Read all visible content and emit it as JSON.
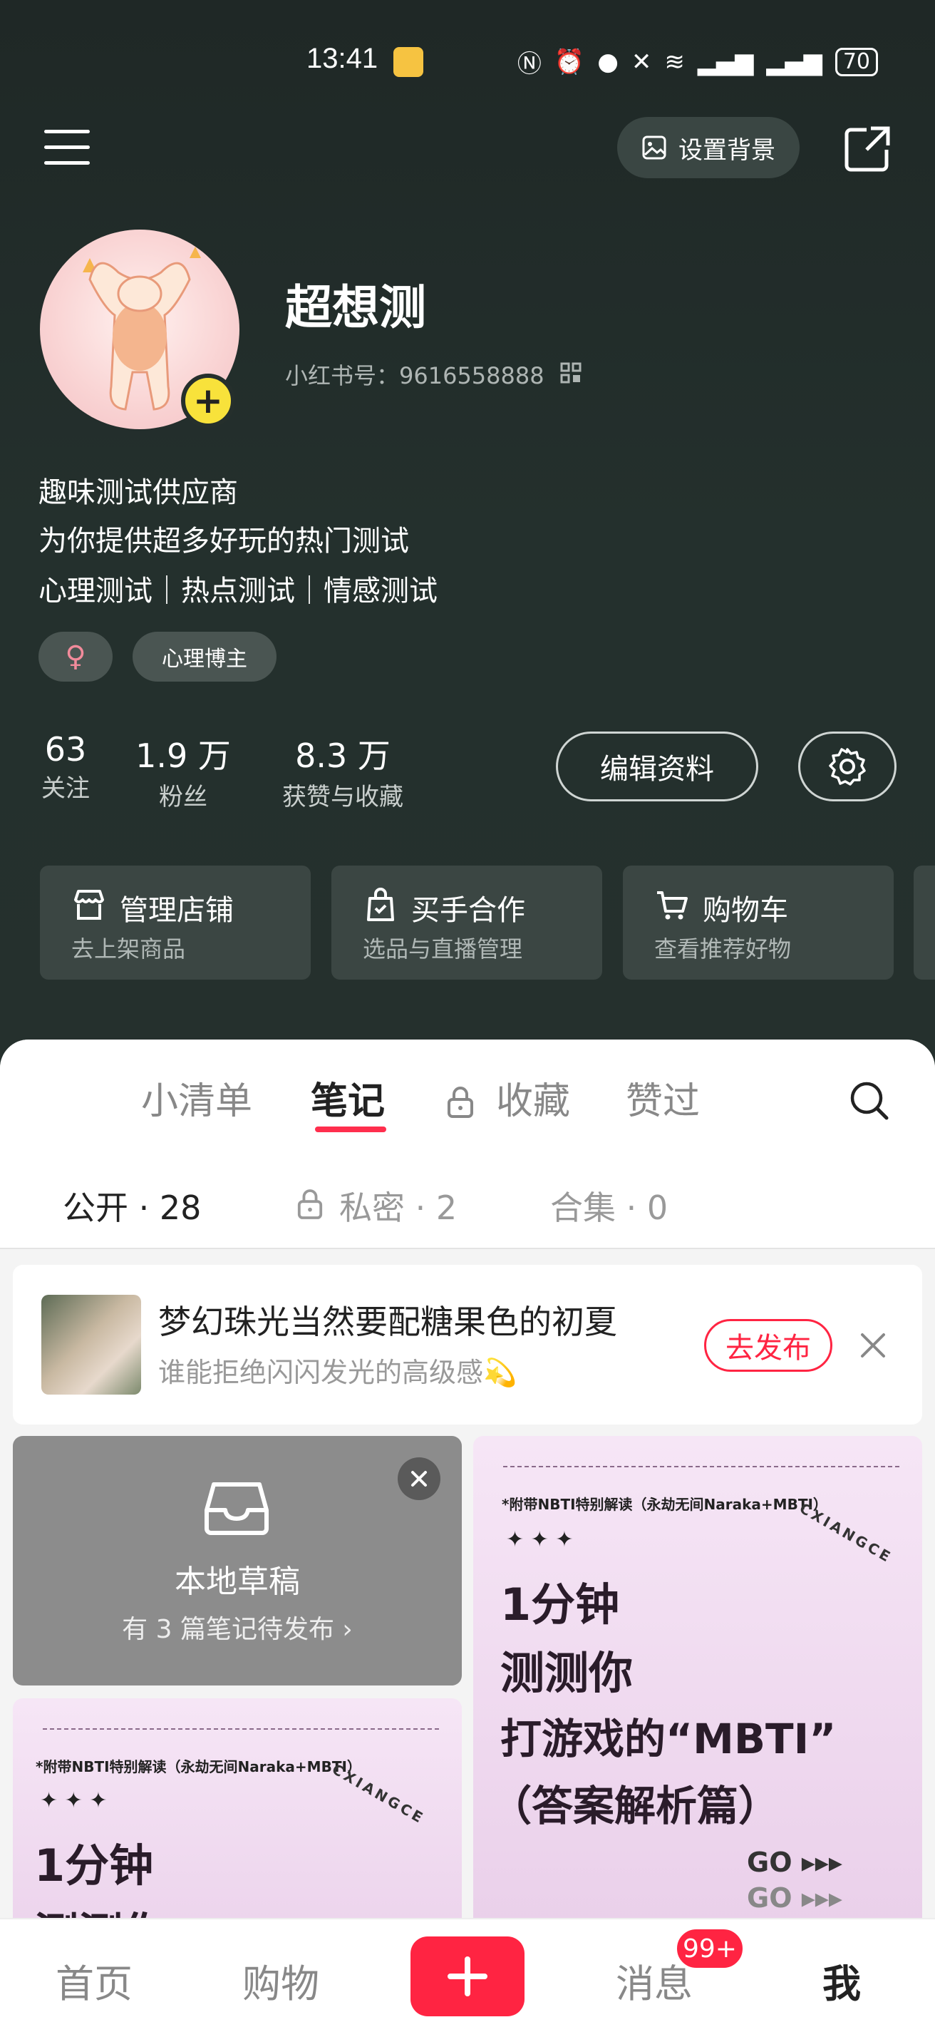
{
  "status_bar": {
    "time": "13:41",
    "battery": "70"
  },
  "header": {
    "set_bg_label": "设置背景"
  },
  "profile": {
    "name": "超想测",
    "red_id": "小红书号：9616558888",
    "bio": [
      "趣味测试供应商",
      "为你提供超多好玩的热门测试",
      "心理测试｜热点测试｜情感测试"
    ],
    "gender_symbol": "♀",
    "tag": "心理博主"
  },
  "stats": [
    {
      "value": "63",
      "label": "关注"
    },
    {
      "value": "1.9 万",
      "label": "粉丝"
    },
    {
      "value": "8.3 万",
      "label": "获赞与收藏"
    }
  ],
  "edit_profile_label": "编辑资料",
  "service_cards": [
    {
      "title": "管理店铺",
      "subtitle": "去上架商品",
      "icon": "store-icon"
    },
    {
      "title": "买手合作",
      "subtitle": "选品与直播管理",
      "icon": "bag-icon"
    },
    {
      "title": "购物车",
      "subtitle": "查看推荐好物",
      "icon": "cart-icon"
    }
  ],
  "tabs": [
    "小清单",
    "笔记",
    "收藏",
    "赞过"
  ],
  "active_tab": "笔记",
  "subtabs": [
    {
      "label": "公开",
      "count": "· 28"
    },
    {
      "label": "私密",
      "count": "· 2"
    },
    {
      "label": "合集",
      "count": "· 0"
    }
  ],
  "banner": {
    "title": "梦幻珠光当然要配糖果色的初夏",
    "subtitle": "谁能拒绝闪闪发光的高级感💫",
    "button": "去发布"
  },
  "draft": {
    "title": "本地草稿",
    "subtitle": "有 3 篇笔记待发布 ›"
  },
  "note_card": {
    "subheading": "*附带NBTI特别解读（永劫无间Naraka+MBTI）",
    "brand": "CXIANGCE",
    "line1": "1分钟",
    "line2": "测测你",
    "line3": "打游戏的“MBTI”",
    "line4": "（答案解析篇）",
    "go": "GO ▸▸▸"
  },
  "nav": {
    "home": "首页",
    "shop": "购物",
    "messages": "消息",
    "badge": "99+",
    "me": "我"
  },
  "colors": {
    "accent": "#ff2442",
    "header_bg": "#25302d",
    "note_bg": "#efd8ef"
  }
}
